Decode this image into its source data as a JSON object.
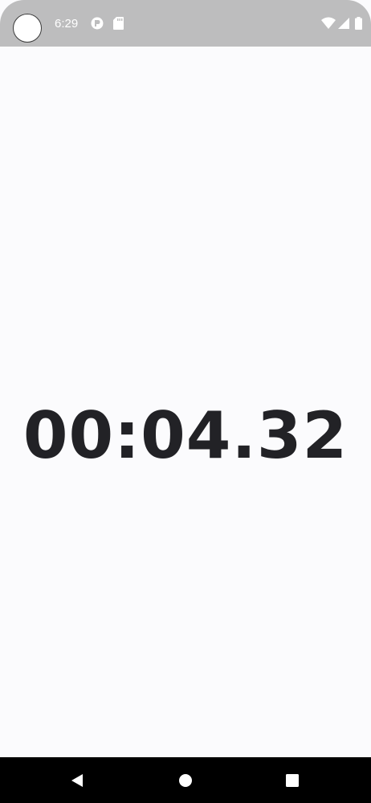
{
  "status_bar": {
    "time": "6:29",
    "icons": [
      "camera-cutout",
      "app-notification-icon",
      "sd-card-icon",
      "wifi-icon",
      "signal-icon",
      "battery-icon"
    ]
  },
  "stopwatch": {
    "elapsed": "00:04.32"
  },
  "navigation_bar": {
    "buttons": [
      "back-icon",
      "home-icon",
      "recents-icon"
    ]
  },
  "colors": {
    "status_bar_bg": "#bdbdbe",
    "background": "#fbfbfd",
    "timer_text": "#222226",
    "nav_bar_bg": "#000000"
  }
}
